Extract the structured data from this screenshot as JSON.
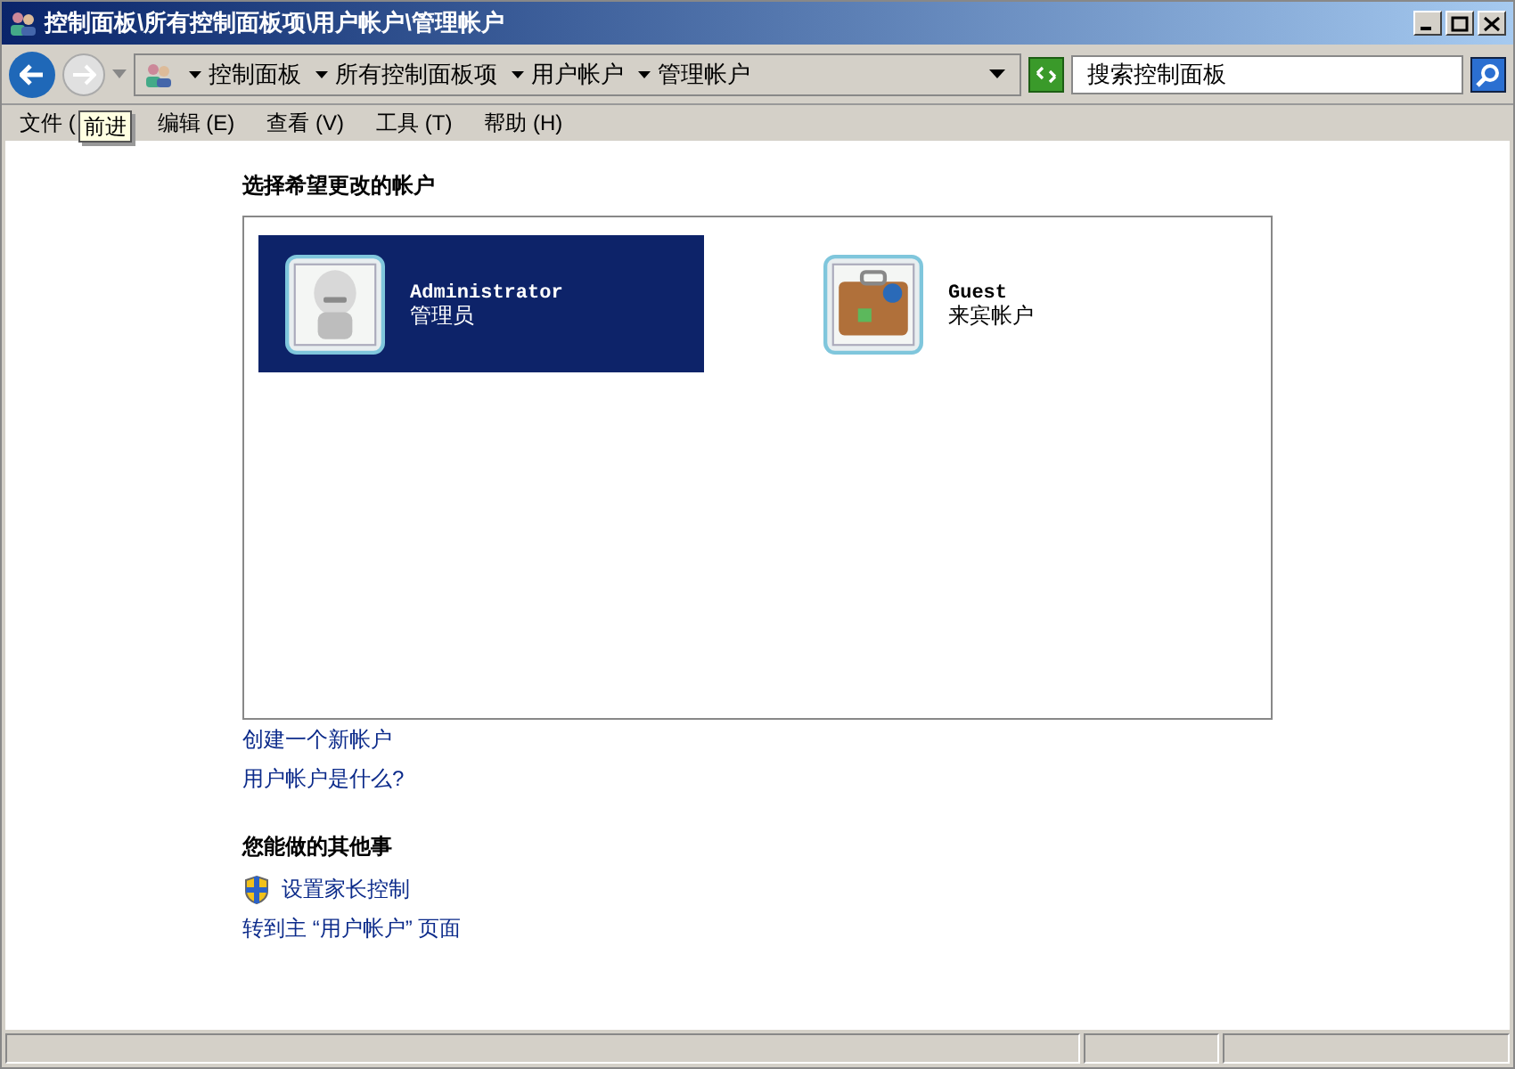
{
  "window": {
    "title": "控制面板\\所有控制面板项\\用户帐户\\管理帐户"
  },
  "breadcrumb": [
    "控制面板",
    "所有控制面板项",
    "用户帐户",
    "管理帐户"
  ],
  "search": {
    "placeholder": "搜索控制面板"
  },
  "menu": [
    "文件 (",
    "编辑 (E)",
    "查看 (V)",
    "工具 (T)",
    "帮助 (H)"
  ],
  "tooltip": "前进",
  "heading": "选择希望更改的帐户",
  "accounts": [
    {
      "name": "Administrator",
      "role": "管理员",
      "kind": "robot",
      "selected": true
    },
    {
      "name": "Guest",
      "role": "来宾帐户",
      "kind": "suitcase",
      "selected": false
    }
  ],
  "links": [
    "创建一个新帐户",
    "用户帐户是什么?"
  ],
  "other_heading": "您能做的其他事",
  "other_links": [
    {
      "label": "设置家长控制",
      "kind": "shield"
    },
    {
      "label": "转到主 “用户帐户” 页面",
      "kind": "plain"
    }
  ]
}
